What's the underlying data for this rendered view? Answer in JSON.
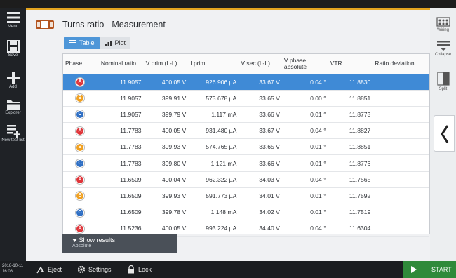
{
  "left_nav": [
    {
      "label": "Menu",
      "icon": "menu-icon"
    },
    {
      "label": "Save",
      "icon": "save-icon"
    },
    {
      "label": "Add",
      "icon": "plus-icon"
    },
    {
      "label": "Explorer",
      "icon": "folder-icon"
    },
    {
      "label": "New test list",
      "icon": "new-test-list-icon"
    }
  ],
  "right_nav": [
    {
      "label": "Wiring",
      "icon": "wiring-icon"
    },
    {
      "label": "Collapse",
      "icon": "collapse-icon"
    },
    {
      "label": "Split",
      "icon": "split-icon"
    }
  ],
  "header": {
    "title": "Turns ratio - Measurement"
  },
  "tabs": [
    {
      "label": "Table",
      "active": true
    },
    {
      "label": "Plot",
      "active": false
    }
  ],
  "table": {
    "columns": [
      "Phase",
      "Nominal ratio",
      "V prim (L-L)",
      "I prim",
      "V sec (L-L)",
      "V phase absolute",
      "VTR",
      "Ratio deviation"
    ],
    "rows": [
      {
        "phase": "A",
        "color": "#e0353a",
        "nominal": "11.9057",
        "vprim": "400.05 V",
        "iprim": "926.906 µA",
        "vsec": "33.67 V",
        "vphase": "0.04 °",
        "vtr": "11.8830",
        "dev": ""
      },
      {
        "phase": "B",
        "color": "#f0a020",
        "nominal": "11.9057",
        "vprim": "399.91 V",
        "iprim": "573.678 µA",
        "vsec": "33.65 V",
        "vphase": "0.00 °",
        "vtr": "11.8851",
        "dev": ""
      },
      {
        "phase": "C",
        "color": "#2f6fc4",
        "nominal": "11.9057",
        "vprim": "399.79 V",
        "iprim": "1.117 mA",
        "vsec": "33.66 V",
        "vphase": "0.01 °",
        "vtr": "11.8773",
        "dev": ""
      },
      {
        "phase": "A",
        "color": "#e0353a",
        "nominal": "11.7783",
        "vprim": "400.05 V",
        "iprim": "931.480 µA",
        "vsec": "33.67 V",
        "vphase": "0.04 °",
        "vtr": "11.8827",
        "dev": ""
      },
      {
        "phase": "B",
        "color": "#f0a020",
        "nominal": "11.7783",
        "vprim": "399.93 V",
        "iprim": "574.765 µA",
        "vsec": "33.65 V",
        "vphase": "0.01 °",
        "vtr": "11.8851",
        "dev": ""
      },
      {
        "phase": "C",
        "color": "#2f6fc4",
        "nominal": "11.7783",
        "vprim": "399.80 V",
        "iprim": "1.121 mA",
        "vsec": "33.66 V",
        "vphase": "0.01 °",
        "vtr": "11.8776",
        "dev": ""
      },
      {
        "phase": "A",
        "color": "#e0353a",
        "nominal": "11.6509",
        "vprim": "400.04 V",
        "iprim": "962.322 µA",
        "vsec": "34.03 V",
        "vphase": "0.04 °",
        "vtr": "11.7565",
        "dev": ""
      },
      {
        "phase": "B",
        "color": "#f0a020",
        "nominal": "11.6509",
        "vprim": "399.93 V",
        "iprim": "591.773 µA",
        "vsec": "34.01 V",
        "vphase": "0.01 °",
        "vtr": "11.7592",
        "dev": ""
      },
      {
        "phase": "C",
        "color": "#2f6fc4",
        "nominal": "11.6509",
        "vprim": "399.78 V",
        "iprim": "1.148 mA",
        "vsec": "34.02 V",
        "vphase": "0.01 °",
        "vtr": "11.7519",
        "dev": ""
      },
      {
        "phase": "A",
        "color": "#e0353a",
        "nominal": "11.5236",
        "vprim": "400.05 V",
        "iprim": "993.224 µA",
        "vsec": "34.40 V",
        "vphase": "0.04 °",
        "vtr": "11.6304",
        "dev": ""
      }
    ]
  },
  "results_button": {
    "label": "Show results",
    "sub": "Absolute"
  },
  "bottom_bar": {
    "datetime": "2018-10-11 16:08",
    "eject": "Eject",
    "settings": "Settings",
    "lock": "Lock",
    "start": "START"
  },
  "colors": {
    "accent": "#4e96d8",
    "selected_row": "#3f8ad6",
    "start": "#2f8a3a",
    "title_bar_accent": "#e3a420"
  }
}
